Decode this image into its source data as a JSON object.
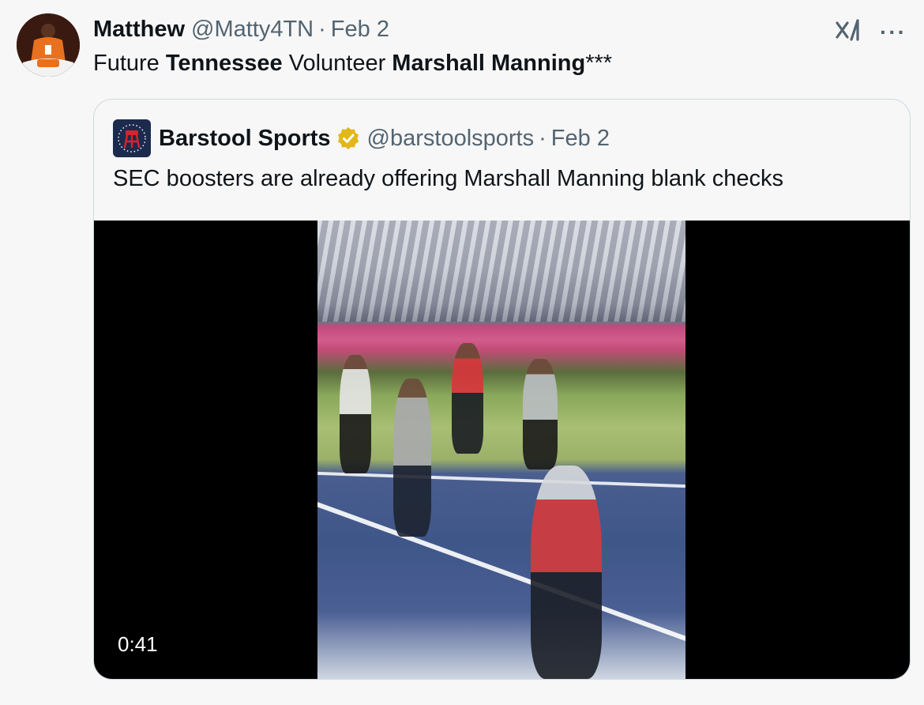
{
  "tweet": {
    "display_name": "Matthew",
    "handle": "@Matty4TN",
    "separator": "·",
    "date": "Feb 2",
    "text_parts": {
      "p1": "Future ",
      "p2": "Tennessee",
      "p3": " Volunteer ",
      "p4": "Marshall Manning",
      "p5": "***"
    }
  },
  "quoted": {
    "display_name": "Barstool Sports",
    "handle": "@barstoolsports",
    "separator": "·",
    "date": "Feb 2",
    "text": "SEC boosters are already offering Marshall Manning blank checks",
    "verified": true,
    "video": {
      "duration": "0:41"
    }
  },
  "icons": {
    "grok": "grok-icon",
    "more": "more-icon",
    "verified": "verified-badge-icon",
    "barstool_logo": "barstool-logo"
  },
  "colors": {
    "text_primary": "#0f1419",
    "text_secondary": "#536471",
    "border": "#cfd9de",
    "verified_gold": "#e2b719",
    "background": "#f7f7f7"
  }
}
